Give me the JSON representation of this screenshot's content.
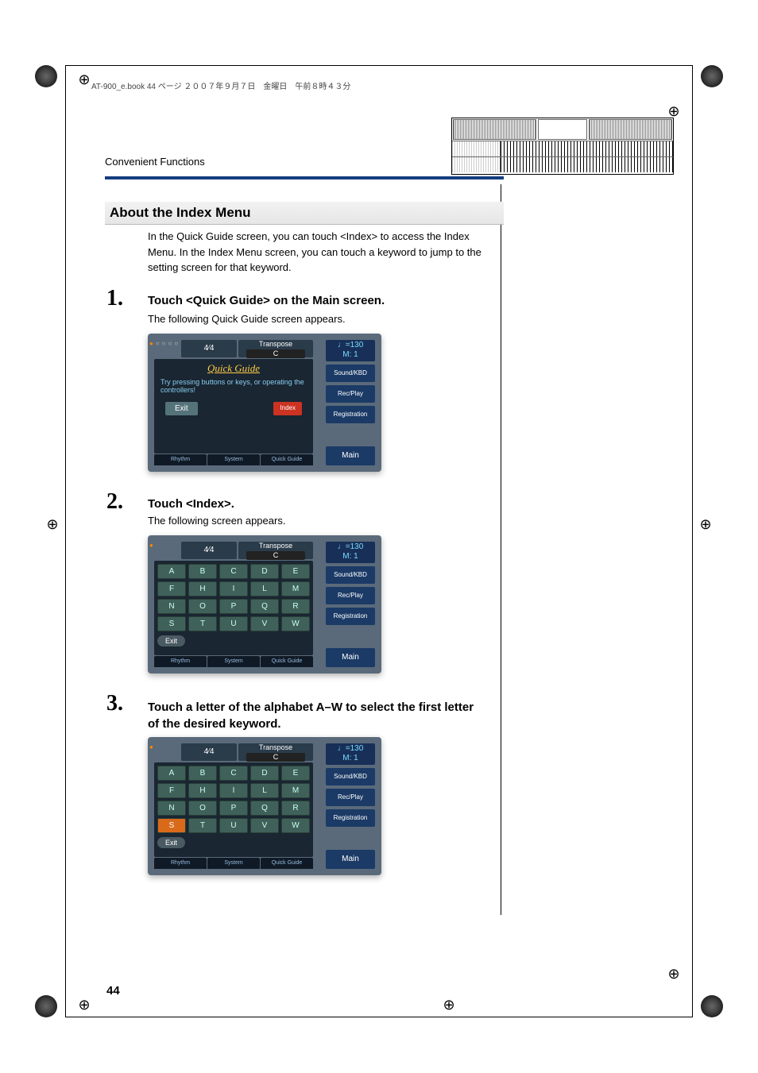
{
  "header_text": "AT-900_e.book  44 ページ  ２００７年９月７日　金曜日　午前８時４３分",
  "section_header": "Convenient Functions",
  "subsection_title": "About the Index Menu",
  "intro_text": "In the Quick Guide screen, you can touch <Index> to access the Index Menu. In the Index Menu screen, you can touch a keyword to jump to the setting screen for that keyword.",
  "steps": {
    "s1": {
      "num": "1.",
      "title": "Touch <Quick Guide> on the Main screen.",
      "sub": "The following Quick Guide screen appears."
    },
    "s2": {
      "num": "2.",
      "title": "Touch <Index>.",
      "sub": "The following screen appears."
    },
    "s3": {
      "num": "3.",
      "title": "Touch a letter of the alphabet A–W to select the first letter of the desired keyword."
    }
  },
  "screenshot_common": {
    "time_sig": "4⁄4",
    "transpose_label": "Transpose",
    "transpose_value": "C",
    "tempo_label": "♩=130",
    "measure_label": "M:    1",
    "side_buttons": [
      "Sound/KBD",
      "Rec/Play",
      "Registration"
    ],
    "main_button": "Main",
    "tabs": [
      "Rhythm",
      "System",
      "Quick Guide"
    ]
  },
  "quick_guide_screen": {
    "title": "Quick Guide",
    "message": "Try pressing buttons or keys, or operating the controllers!",
    "exit": "Exit",
    "index": "Index"
  },
  "index_screen": {
    "rows": [
      [
        "A",
        "B",
        "C",
        "D",
        "E"
      ],
      [
        "F",
        "H",
        "I",
        "L",
        "M"
      ],
      [
        "N",
        "O",
        "P",
        "Q",
        "R"
      ],
      [
        "S",
        "T",
        "U",
        "V",
        "W"
      ]
    ],
    "exit": "Exit",
    "selected_ss3": "S"
  },
  "page_number": "44"
}
